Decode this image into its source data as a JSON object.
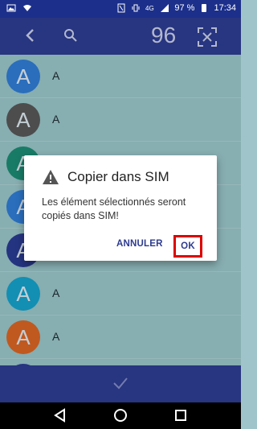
{
  "status_bar": {
    "battery": "97 %",
    "time": "17:34",
    "icons": [
      "image-icon",
      "wifi-icon",
      "nfc-icon",
      "vibrate-icon",
      "4g-icon",
      "signal-icon",
      "battery-icon"
    ]
  },
  "app_bar": {
    "selected_count": "96",
    "icons": [
      "back-arrow-icon",
      "search-icon",
      "select-all-icon"
    ]
  },
  "contacts": [
    {
      "initial": "A",
      "name": "A",
      "color": "#2f7bd2"
    },
    {
      "initial": "A",
      "name": "A",
      "color": "#565656"
    },
    {
      "initial": "A",
      "name": "",
      "color": "#1b8a72"
    },
    {
      "initial": "A",
      "name": "",
      "color": "#2f7bd2"
    },
    {
      "initial": "A",
      "name": "",
      "color": "#2a3a8f"
    },
    {
      "initial": "A",
      "name": "A",
      "color": "#15a0c8"
    },
    {
      "initial": "A",
      "name": "A",
      "color": "#d66423"
    },
    {
      "initial": "A",
      "name": "",
      "color": "#2a3a8f"
    }
  ],
  "dialog": {
    "title": "Copier dans SIM",
    "message": "Les élément sélectionnés seront copiés dans SIM!",
    "cancel_label": "ANNULER",
    "ok_label": "OK"
  },
  "bottom_bar": {
    "icon": "check-icon"
  },
  "nav_bar": {
    "icons": [
      "back-icon",
      "home-icon",
      "recents-icon"
    ]
  },
  "colors": {
    "app_bar": "#2d3b8f",
    "status_bar": "#1c2f8a",
    "highlight": "#dd0000"
  }
}
